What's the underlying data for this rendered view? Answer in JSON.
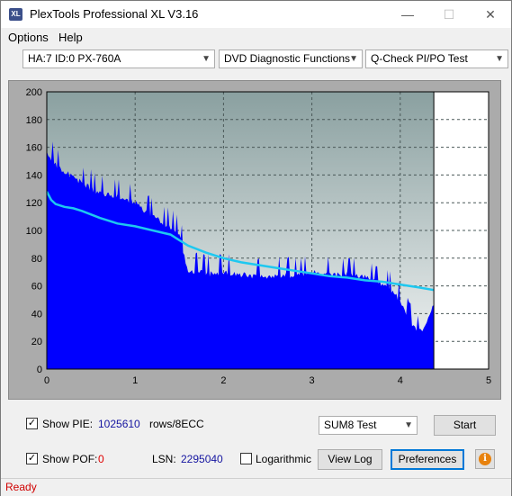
{
  "window": {
    "icon_text": "XL",
    "title": "PlexTools Professional XL V3.16",
    "minimize": "—",
    "maximize": "☐",
    "close": "✕"
  },
  "menu": {
    "options": "Options",
    "help": "Help"
  },
  "toolbar": {
    "drive": "HA:7 ID:0  PX-760A",
    "function": "DVD Diagnostic Functions",
    "test": "Q-Check PI/PO Test"
  },
  "chart_data": {
    "type": "area",
    "title": "",
    "xlabel": "",
    "ylabel": "",
    "xlim": [
      0,
      5
    ],
    "ylim": [
      0,
      200
    ],
    "x_ticks": [
      "0",
      "1",
      "2",
      "3",
      "4",
      "5"
    ],
    "y_ticks": [
      "0",
      "20",
      "40",
      "60",
      "80",
      "100",
      "120",
      "140",
      "160",
      "180",
      "200"
    ],
    "grid": true,
    "end_marker_x": 4.38,
    "series": [
      {
        "color": "#0000ff",
        "type": "area",
        "x": [
          0,
          0.05,
          0.1,
          0.2,
          0.3,
          0.4,
          0.5,
          0.6,
          0.7,
          0.8,
          0.9,
          1.0,
          1.1,
          1.2,
          1.3,
          1.4,
          1.5,
          1.6,
          1.7,
          1.8,
          1.9,
          2.0,
          2.2,
          2.4,
          2.6,
          2.8,
          3.0,
          3.2,
          3.4,
          3.6,
          3.8,
          3.9,
          4.0,
          4.05,
          4.1,
          4.15,
          4.2,
          4.25,
          4.3,
          4.35,
          4.38
        ],
        "values": [
          155,
          150,
          145,
          140,
          136,
          132,
          128,
          125,
          124,
          122,
          120,
          118,
          112,
          108,
          104,
          100,
          96,
          67,
          68,
          67,
          66,
          68,
          66,
          64,
          66,
          65,
          68,
          66,
          66,
          64,
          58,
          54,
          47,
          40,
          34,
          28,
          24,
          26,
          32,
          40,
          46
        ]
      },
      {
        "color": "#1ec8f0",
        "type": "line",
        "x": [
          0,
          0.05,
          0.1,
          0.2,
          0.3,
          0.4,
          0.6,
          0.8,
          1.0,
          1.2,
          1.4,
          1.5,
          1.6,
          1.8,
          2.0,
          2.2,
          2.4,
          2.6,
          2.8,
          3.0,
          3.2,
          3.4,
          3.6,
          3.8,
          4.0,
          4.2,
          4.38
        ],
        "values": [
          128,
          122,
          119,
          117,
          116,
          114,
          109,
          105,
          103,
          100,
          97,
          93,
          89,
          84,
          80,
          77,
          75,
          73,
          71,
          69,
          67,
          66,
          64,
          63,
          61,
          59,
          57
        ]
      }
    ]
  },
  "controls": {
    "show_pie_label": "Show PIE:",
    "pie_value": "1025610",
    "pie_unit": "rows/8ECC",
    "show_pof_label": "Show POF:",
    "pof_value": "0",
    "lsn_label": "LSN:",
    "lsn_value": "2295040",
    "logarithmic_label": "Logarithmic",
    "sum_test": "SUM8 Test",
    "start_label": "Start",
    "view_log_label": "View Log",
    "preferences_label": "Preferences",
    "info_glyph": "i",
    "check_mark": "✓"
  },
  "status": {
    "text": "Ready"
  }
}
